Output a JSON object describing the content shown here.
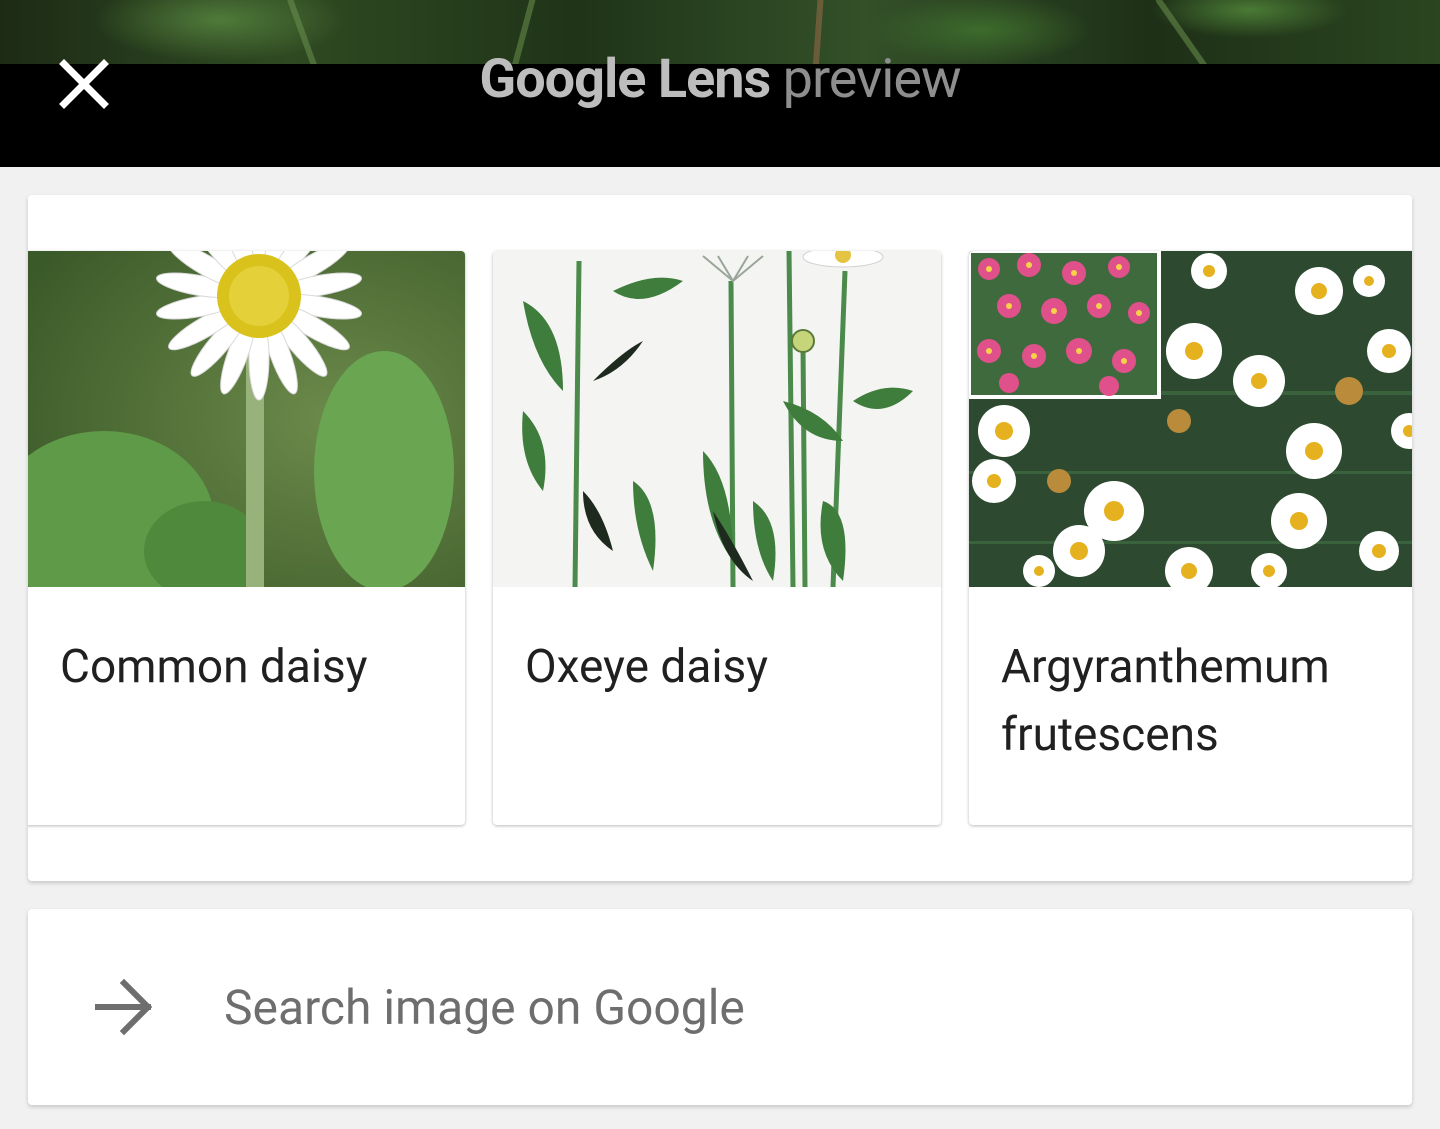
{
  "header": {
    "close_icon": "close-icon",
    "title_brand": "Google Lens",
    "title_suffix": " preview"
  },
  "results": [
    {
      "label": "Common daisy",
      "image": "white daisy with yellow center on green leaves"
    },
    {
      "label": "Oxeye daisy",
      "image": "botanical illustration of stems and leaves"
    },
    {
      "label": "Argyranthemum frutescens",
      "image": "field of white and pink marguerite daisies"
    }
  ],
  "search": {
    "icon": "arrow-right-icon",
    "label": "Search image on Google"
  },
  "colors": {
    "header_bg": "#000000",
    "page_bg": "#f1f1f1",
    "card_bg": "#ffffff",
    "text_primary": "#202020",
    "text_secondary": "#6e6e6e"
  }
}
